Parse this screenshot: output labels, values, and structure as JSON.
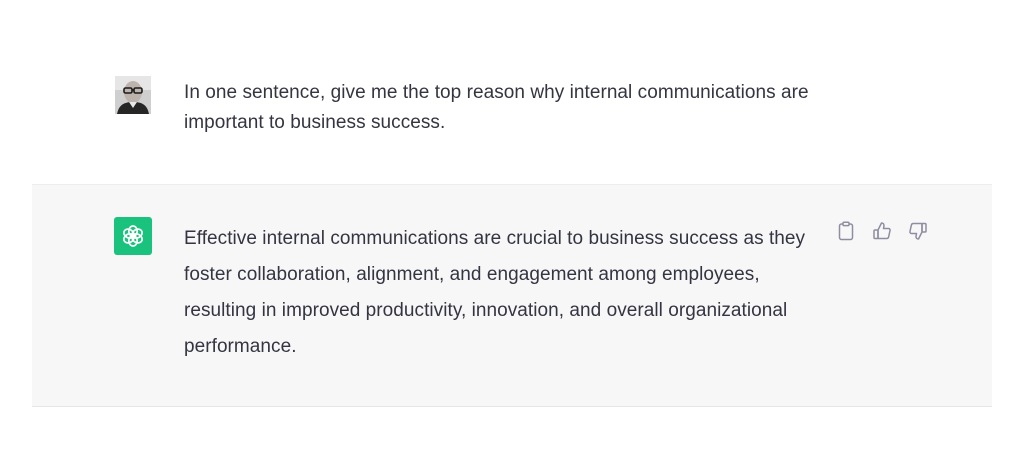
{
  "conversation": {
    "user_message": {
      "avatar": "user-photo-avatar",
      "text": "In one sentence, give me the top reason why internal communications are important to business success."
    },
    "assistant_message": {
      "avatar": "openai-logo-icon",
      "avatar_color": "#19c37d",
      "text": "Effective internal communications are crucial to business success as they foster collaboration, alignment, and engagement among employees, resulting in improved productivity, innovation, and overall organizational performance.",
      "actions": [
        {
          "icon": "clipboard-icon"
        },
        {
          "icon": "thumbs-up-icon"
        },
        {
          "icon": "thumbs-down-icon"
        }
      ]
    }
  }
}
